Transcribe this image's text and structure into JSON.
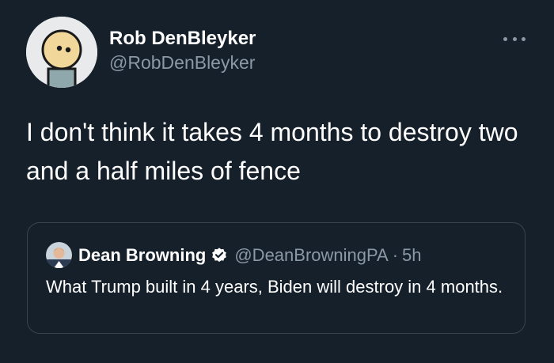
{
  "tweet": {
    "author_name": "Rob DenBleyker",
    "author_handle": "@RobDenBleyker",
    "text": "I don't think it takes 4 months to destroy two and a half miles of fence",
    "more_icon": "more-horizontal-icon"
  },
  "quoted_tweet": {
    "author_name": "Dean Browning",
    "author_handle": "@DeanBrowningPA",
    "separator": "·",
    "time": "5h",
    "text": "What Trump built in 4 years, Biden will destroy in 4 months.",
    "verified_icon": "verified-badge-icon"
  },
  "colors": {
    "background": "#15202b",
    "primary_text": "#ffffff",
    "secondary_text": "#8b98a5",
    "border": "#38444d"
  }
}
